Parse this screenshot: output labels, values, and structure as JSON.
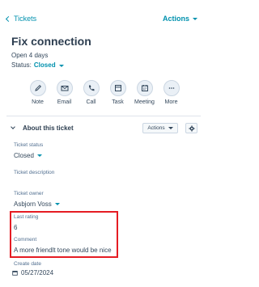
{
  "header": {
    "back_label": "Tickets",
    "actions_label": "Actions"
  },
  "ticket": {
    "title": "Fix connection",
    "open_duration": "Open 4 days",
    "status_prefix": "Status:",
    "status_value": "Closed"
  },
  "quick_actions": [
    {
      "label": "Note",
      "icon": "note-icon"
    },
    {
      "label": "Email",
      "icon": "email-icon"
    },
    {
      "label": "Call",
      "icon": "phone-icon"
    },
    {
      "label": "Task",
      "icon": "task-icon"
    },
    {
      "label": "Meeting",
      "icon": "calendar-icon"
    },
    {
      "label": "More",
      "icon": "more-icon"
    }
  ],
  "about_section": {
    "title": "About this ticket",
    "actions_label": "Actions"
  },
  "properties": {
    "ticket_status": {
      "label": "Ticket status",
      "value": "Closed"
    },
    "ticket_description": {
      "label": "Ticket description",
      "value": ""
    },
    "ticket_owner": {
      "label": "Ticket owner",
      "value": "Asbjorn Voss"
    },
    "last_rating": {
      "label": "Last rating",
      "value": "6"
    },
    "comment": {
      "label": "Comment",
      "value": "A more friendlt tone would be nice"
    },
    "create_date": {
      "label": "Create date",
      "value": "05/27/2024"
    }
  },
  "colors": {
    "link": "#0091ae",
    "text": "#33475b",
    "highlight": "#e51c23"
  }
}
